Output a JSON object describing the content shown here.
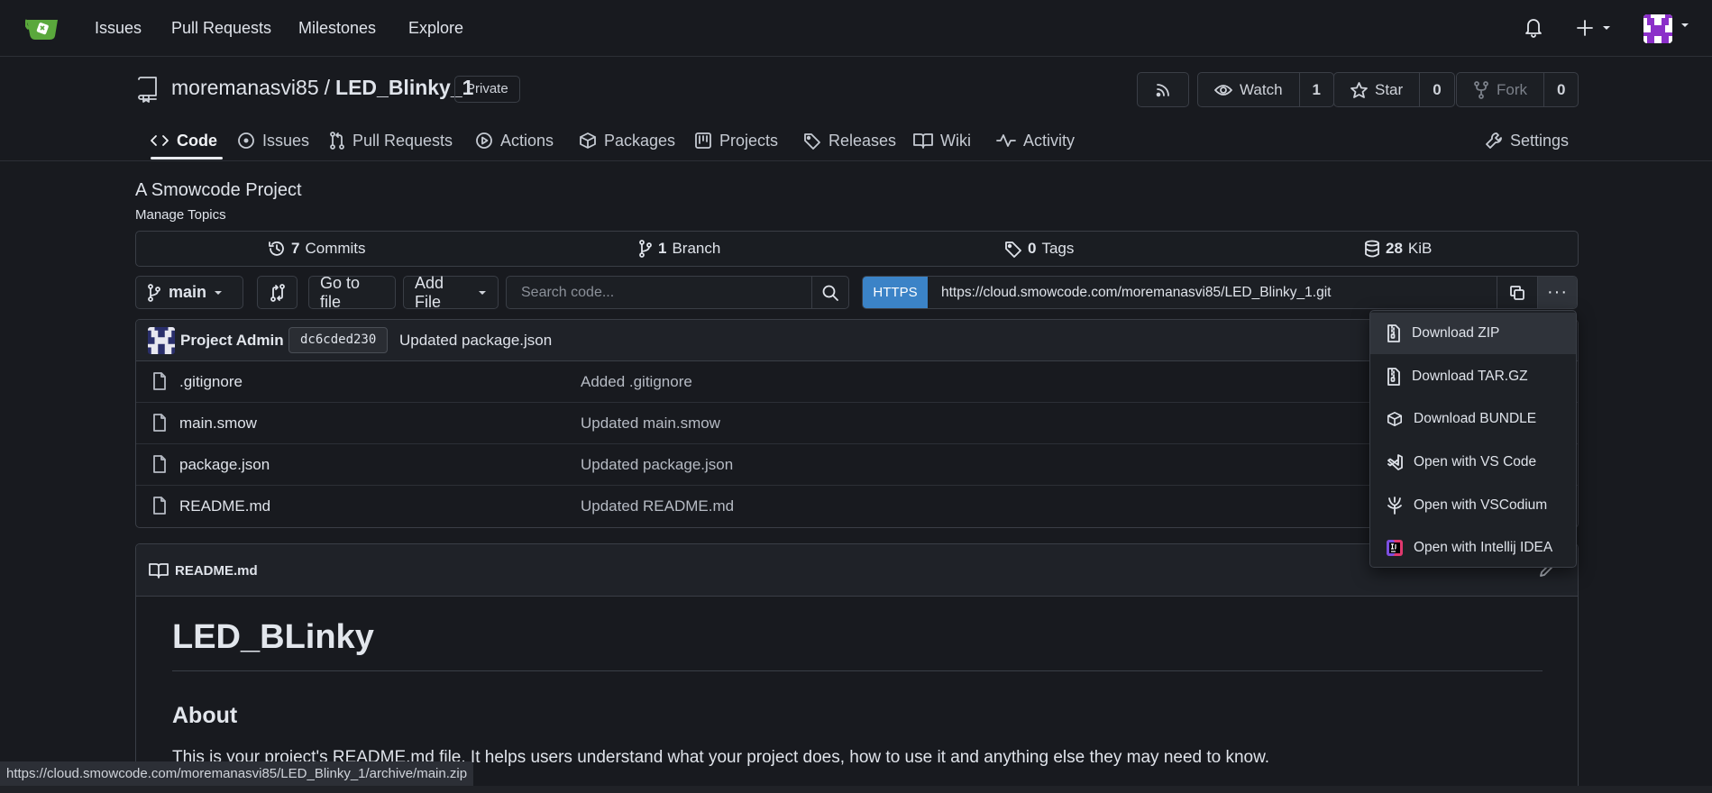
{
  "nav": {
    "links": [
      "Issues",
      "Pull Requests",
      "Milestones",
      "Explore"
    ]
  },
  "repo": {
    "owner": "moremanasvi85",
    "separator": "/",
    "name": "LED_Blinky_1",
    "visibility": "Private",
    "watch_label": "Watch",
    "watch_count": "1",
    "star_label": "Star",
    "star_count": "0",
    "fork_label": "Fork",
    "fork_count": "0"
  },
  "tabs": [
    {
      "label": "Code",
      "icon": "code-icon",
      "active": true
    },
    {
      "label": "Issues",
      "icon": "issue-icon"
    },
    {
      "label": "Pull Requests",
      "icon": "pull-request-icon"
    },
    {
      "label": "Actions",
      "icon": "play-icon"
    },
    {
      "label": "Packages",
      "icon": "package-icon"
    },
    {
      "label": "Projects",
      "icon": "project-icon"
    },
    {
      "label": "Releases",
      "icon": "tag-icon"
    },
    {
      "label": "Wiki",
      "icon": "book-icon"
    },
    {
      "label": "Activity",
      "icon": "pulse-icon"
    }
  ],
  "settings_label": "Settings",
  "description": "A Smowcode Project",
  "manage_topics": "Manage Topics",
  "stats": {
    "commits_count": "7",
    "commits_label": "Commits",
    "branch_count": "1",
    "branch_label": "Branch",
    "tags_count": "0",
    "tags_label": "Tags",
    "size_value": "28",
    "size_unit": "KiB"
  },
  "toolbar": {
    "branch": "main",
    "go_to_file": "Go to file",
    "add_file": "Add File",
    "search_placeholder": "Search code...",
    "protocol": "HTTPS",
    "clone_url": "https://cloud.smowcode.com/moremanasvi85/LED_Blinky_1.git",
    "more": "···"
  },
  "last_commit": {
    "author": "Project Admin",
    "sha": "dc6cded230",
    "message": "Updated package.json"
  },
  "files": [
    {
      "name": ".gitignore",
      "commit": "Added .gitignore"
    },
    {
      "name": "main.smow",
      "commit": "Updated main.smow"
    },
    {
      "name": "package.json",
      "commit": "Updated package.json"
    },
    {
      "name": "README.md",
      "commit": "Updated README.md"
    }
  ],
  "dropdown": [
    {
      "label": "Download ZIP",
      "icon": "file-zip-icon",
      "hover": true
    },
    {
      "label": "Download TAR.GZ",
      "icon": "file-zip-icon"
    },
    {
      "label": "Download BUNDLE",
      "icon": "package-icon"
    },
    {
      "label": "Open with VS Code",
      "icon": "vscode-icon"
    },
    {
      "label": "Open with VSCodium",
      "icon": "vscodium-icon"
    },
    {
      "label": "Open with Intellij IDEA",
      "icon": "intellij-icon"
    }
  ],
  "readme": {
    "filename": "README.md",
    "h1": "LED_BLinky",
    "h2": "About",
    "paragraph": "This is your project's README.md file. It helps users understand what your project does, how to use it and anything else they may need to know."
  },
  "statusbar": "https://cloud.smowcode.com/moremanasvi85/LED_Blinky_1/archive/main.zip",
  "colors": {
    "background": "#181a1f",
    "accent": "#3b83c7",
    "logo": "#5aa83c"
  }
}
